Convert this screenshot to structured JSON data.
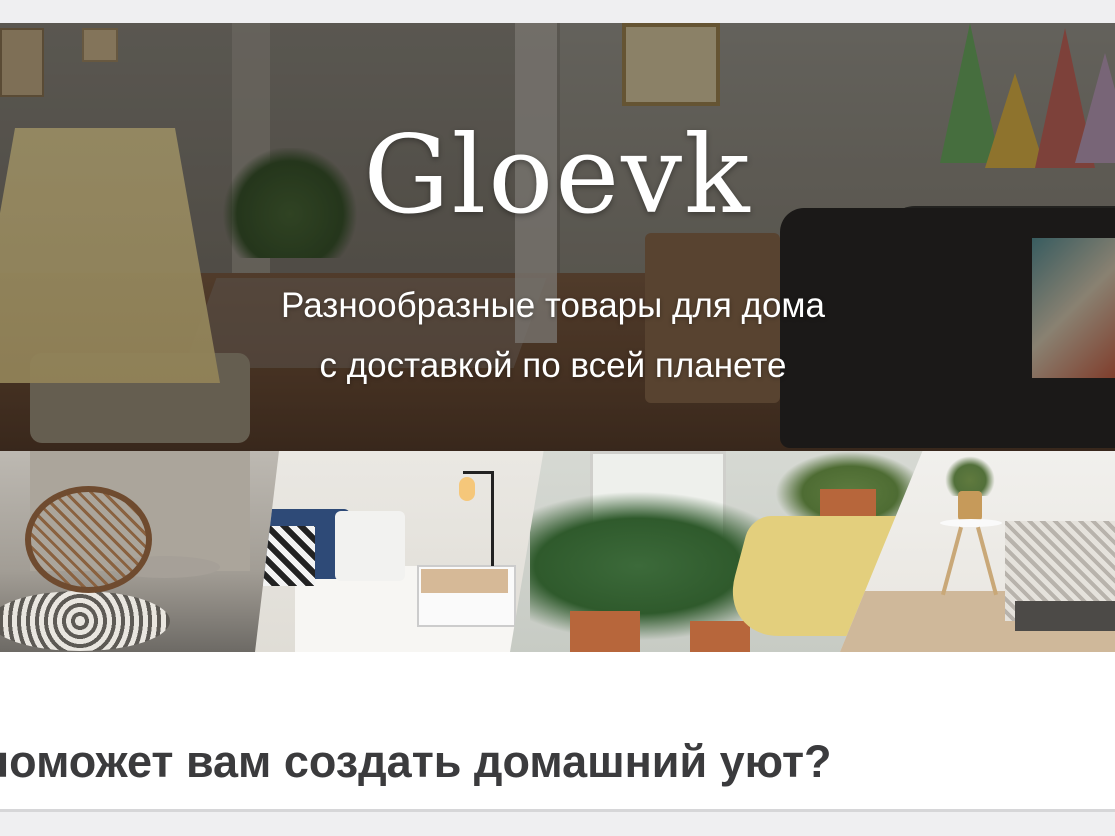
{
  "hero": {
    "logo": "Gloevk",
    "tagline_line1": "Разнообразные товары для дома",
    "tagline_line2": "с доставкой по всей планете"
  },
  "gallery": {
    "panels": [
      {
        "name": "patio-chair-photo"
      },
      {
        "name": "bedroom-photo"
      },
      {
        "name": "plants-photo"
      },
      {
        "name": "bedroom-stool-photo"
      }
    ]
  },
  "section": {
    "heading": "о поможет вам создать домашний уют?"
  },
  "colors": {
    "page_background": "#efeff1",
    "heading_text": "#3b3b3d",
    "hero_text": "#ffffff",
    "card_background": "#ffffff"
  }
}
